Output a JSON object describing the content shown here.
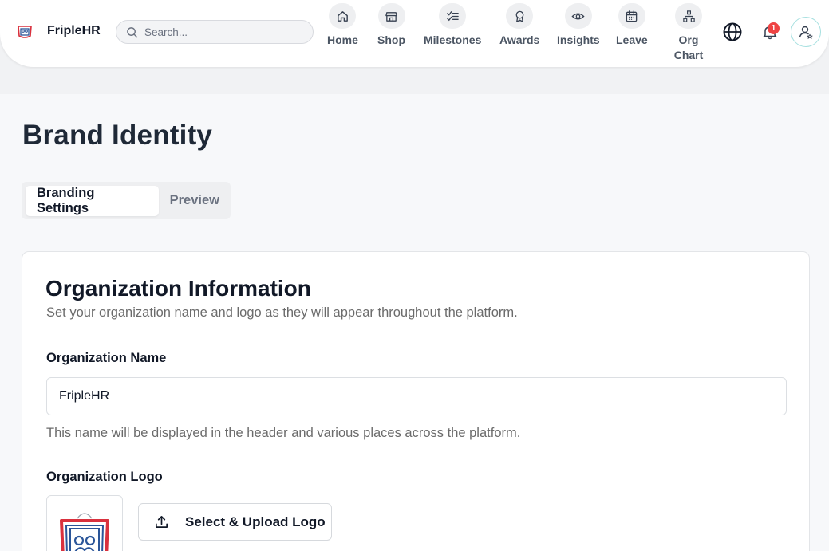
{
  "app": {
    "name": "FripleHR"
  },
  "search": {
    "placeholder": "Search..."
  },
  "nav": {
    "items": [
      {
        "label": "Home",
        "icon": "home-icon"
      },
      {
        "label": "Shop",
        "icon": "shop-icon"
      },
      {
        "label": "Milestones",
        "icon": "checklist-icon"
      },
      {
        "label": "Awards",
        "icon": "award-icon"
      },
      {
        "label": "Insights",
        "icon": "eye-icon"
      },
      {
        "label": "Leave",
        "icon": "calendar-icon"
      },
      {
        "label": "Org Chart",
        "icon": "org-chart-icon"
      }
    ]
  },
  "header": {
    "notification_count": "1"
  },
  "page": {
    "title": "Brand Identity"
  },
  "tabs": [
    {
      "label": "Branding Settings",
      "active": true
    },
    {
      "label": "Preview",
      "active": false
    }
  ],
  "card": {
    "title": "Organization Information",
    "subtitle": "Set your organization name and logo as they will appear throughout the platform.",
    "org_name_label": "Organization Name",
    "org_name_value": "FripleHR",
    "org_name_hint": "This name will be displayed in the header and various places across the platform.",
    "logo_label": "Organization Logo",
    "upload_label": "Select & Upload Logo"
  },
  "colors": {
    "accent": "#ef4444",
    "avatar_ring": "#a7e0e0",
    "brand_red": "#d9313e",
    "brand_blue": "#2a5599"
  }
}
